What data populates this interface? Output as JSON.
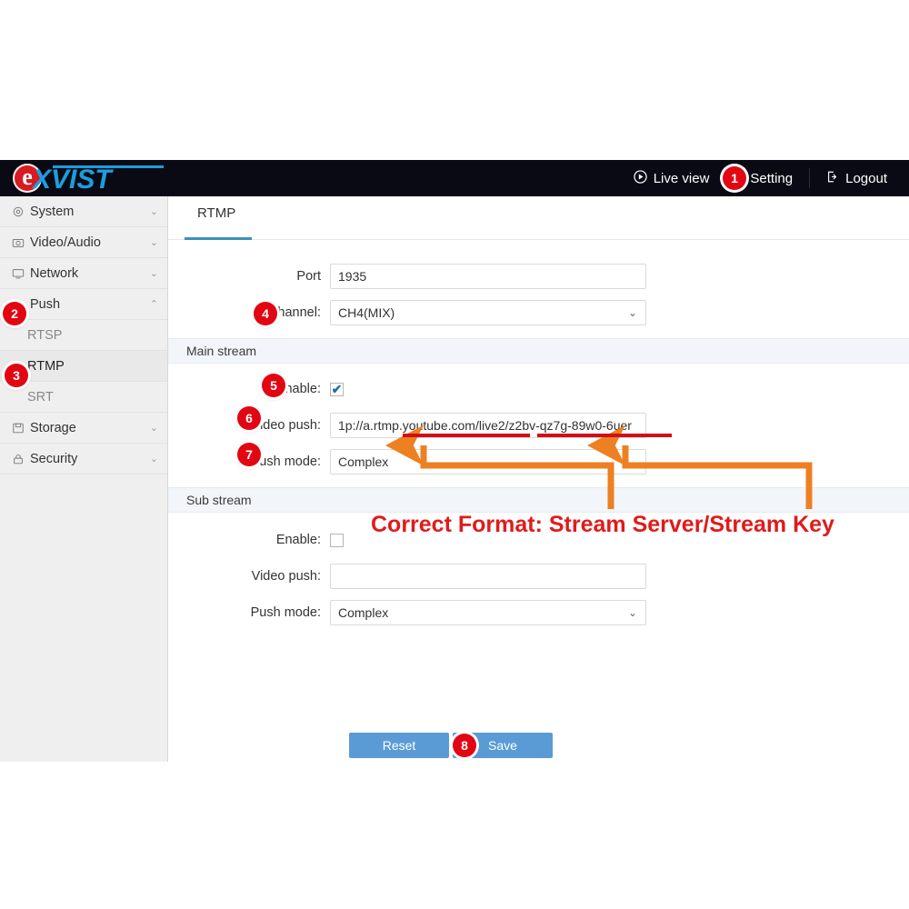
{
  "header": {
    "logo_e": "e",
    "logo_text": "XVIST",
    "live_view": "Live view",
    "setting": "Setting",
    "logout": "Logout",
    "play_icon": "play-circle-icon",
    "logout_icon": "logout-icon",
    "bg_color": "#0a0a14",
    "logo_blue": "#1a9fe0",
    "logo_red": "#d81a21"
  },
  "sidebar": {
    "items": [
      {
        "label": "System",
        "icon": "gear-icon",
        "chevron": "⌄",
        "expanded": false
      },
      {
        "label": "Video/Audio",
        "icon": "camera-icon",
        "chevron": "⌄",
        "expanded": false
      },
      {
        "label": "Network",
        "icon": "monitor-icon",
        "chevron": "⌄",
        "expanded": false
      },
      {
        "label": "Push",
        "icon": "",
        "chevron": "⌃",
        "expanded": true
      },
      {
        "label": "Storage",
        "icon": "save-icon",
        "chevron": "⌄",
        "expanded": false
      },
      {
        "label": "Security",
        "icon": "lock-icon",
        "chevron": "⌄",
        "expanded": false
      }
    ],
    "sub_items": [
      {
        "label": "RTSP",
        "active": false
      },
      {
        "label": "RTMP",
        "active": true
      },
      {
        "label": "SRT",
        "active": false
      }
    ]
  },
  "main": {
    "tab": "RTMP",
    "port_label": "Port",
    "port_value": "1935",
    "channel_label": "Channel:",
    "channel_value": "CH4(MIX)",
    "main_stream_title": "Main stream",
    "sub_stream_title": "Sub stream",
    "enable_label": "Enable:",
    "video_push_label": "Video push:",
    "push_mode_label": "Push mode:",
    "main_enable_checked": true,
    "main_video_push_value": "1p://a.rtmp.youtube.com/live2/z2bv-qz7g-89w0-6uer",
    "main_push_mode_value": "Complex",
    "sub_enable_checked": false,
    "sub_video_push_value": "",
    "sub_push_mode_value": "Complex",
    "reset_label": "Reset",
    "save_label": "Save",
    "button_color": "#5b9bd5",
    "tab_accent": "#3d8fba"
  },
  "annotations": {
    "callout_text": "Correct Format: Stream Server/Stream Key",
    "callout_color": "#e01b1b",
    "arrow_color": "#ed8022",
    "underline_color": "#d10f18",
    "steps": [
      {
        "n": "1",
        "target": "setting-menu"
      },
      {
        "n": "2",
        "target": "sidebar-push"
      },
      {
        "n": "3",
        "target": "sidebar-rtmp"
      },
      {
        "n": "4",
        "target": "channel-field"
      },
      {
        "n": "5",
        "target": "main-enable"
      },
      {
        "n": "6",
        "target": "main-video-push"
      },
      {
        "n": "7",
        "target": "main-push-mode"
      },
      {
        "n": "8",
        "target": "save-button"
      }
    ]
  }
}
